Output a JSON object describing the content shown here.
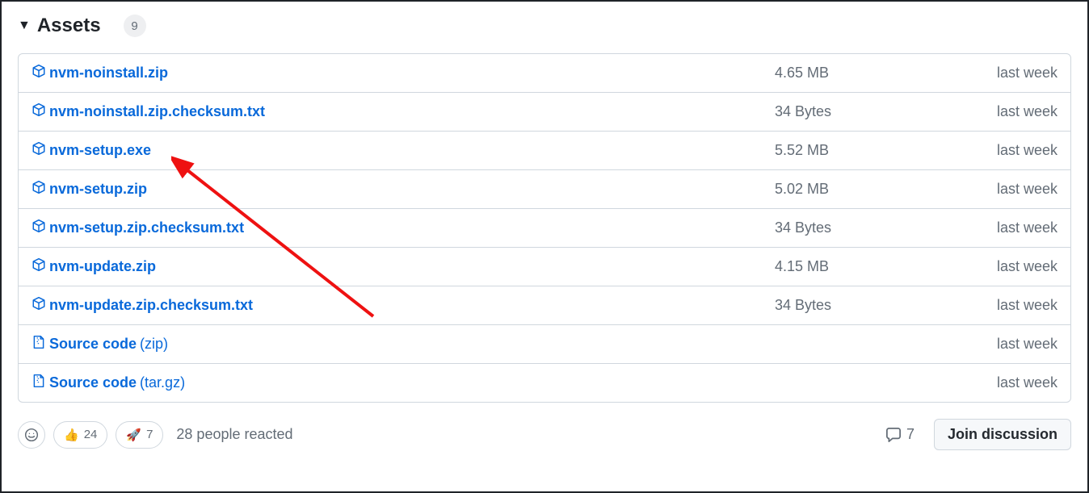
{
  "assets": {
    "title": "Assets",
    "count": "9",
    "items": [
      {
        "name": "nvm-noinstall.zip",
        "size": "4.65 MB",
        "date": "last week",
        "icon": "package"
      },
      {
        "name": "nvm-noinstall.zip.checksum.txt",
        "size": "34 Bytes",
        "date": "last week",
        "icon": "package"
      },
      {
        "name": "nvm-setup.exe",
        "size": "5.52 MB",
        "date": "last week",
        "icon": "package"
      },
      {
        "name": "nvm-setup.zip",
        "size": "5.02 MB",
        "date": "last week",
        "icon": "package"
      },
      {
        "name": "nvm-setup.zip.checksum.txt",
        "size": "34 Bytes",
        "date": "last week",
        "icon": "package"
      },
      {
        "name": "nvm-update.zip",
        "size": "4.15 MB",
        "date": "last week",
        "icon": "package"
      },
      {
        "name": "nvm-update.zip.checksum.txt",
        "size": "34 Bytes",
        "date": "last week",
        "icon": "package"
      },
      {
        "name": "Source code",
        "ext": "(zip)",
        "size": "",
        "date": "last week",
        "icon": "zip"
      },
      {
        "name": "Source code",
        "ext": "(tar.gz)",
        "size": "",
        "date": "last week",
        "icon": "zip"
      }
    ]
  },
  "reactions": {
    "thumbs": "24",
    "rocket": "7",
    "summary": "28 people reacted"
  },
  "comments": {
    "count": "7",
    "join_label": "Join discussion"
  }
}
